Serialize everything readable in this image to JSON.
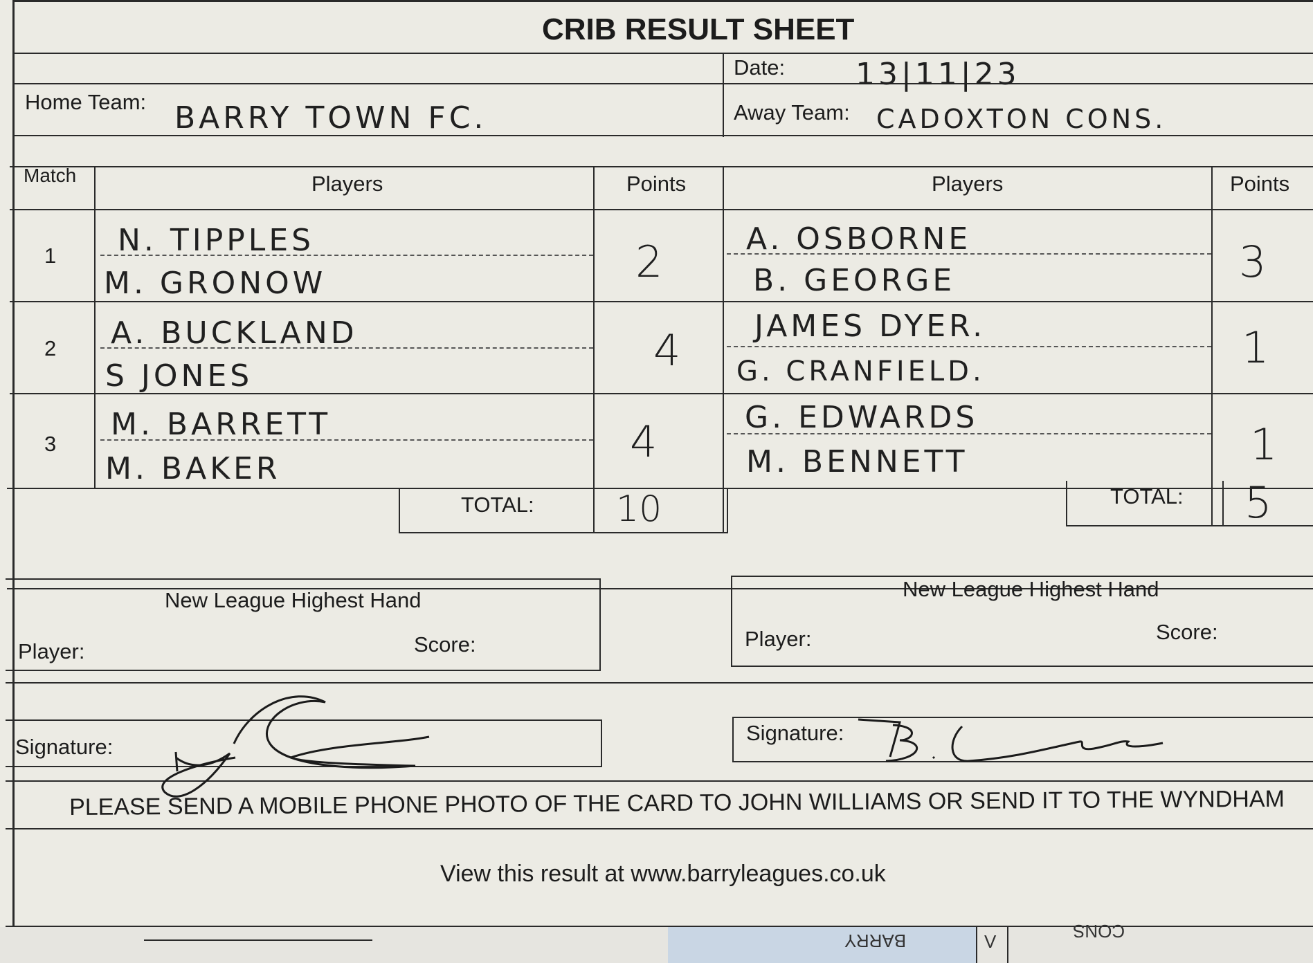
{
  "title": "CRIB RESULT SHEET",
  "date_label": "Date:",
  "date_value": "13|11|23",
  "home_team_label": "Home Team:",
  "home_team_value": "BARRY TOWN FC.",
  "away_team_label": "Away Team:",
  "away_team_value": "CADOXTON CONS.",
  "headers": {
    "match": "Match",
    "home_players": "Players",
    "home_points": "Points",
    "away_players": "Players",
    "away_points": "Points"
  },
  "matches": [
    {
      "number": "1",
      "home_players": [
        "N. TIPPLES",
        "M. GRONOW"
      ],
      "home_points": "2",
      "away_players": [
        "A. OSBORNE",
        "B. GEORGE"
      ],
      "away_points": "3"
    },
    {
      "number": "2",
      "home_players": [
        "A. BUCKLAND",
        "S JONES"
      ],
      "home_points": "4",
      "away_players": [
        "JAMES DYER.",
        "G. CRANFIELD."
      ],
      "away_points": "1"
    },
    {
      "number": "3",
      "home_players": [
        "M. BARRETT",
        "M. BAKER"
      ],
      "home_points": "4",
      "away_players": [
        "G. EDWARDS",
        "M. BENNETT"
      ],
      "away_points": "1"
    }
  ],
  "total_label": "TOTAL:",
  "home_total": "10",
  "away_total": "5",
  "highest_hand_title": "New League Highest Hand",
  "player_label": "Player:",
  "score_label": "Score:",
  "signature_label": "Signature:",
  "footer_line1": "PLEASE SEND A MOBILE PHONE PHOTO OF THE CARD TO JOHN WILLIAMS OR SEND IT TO THE WYNDHAM",
  "footer_line2": "View this result at www.barryleagues.co.uk",
  "bottom_strip": {
    "mirror_text1": "BARRY",
    "mirror_text2": "V",
    "mirror_text3": "CONS"
  }
}
